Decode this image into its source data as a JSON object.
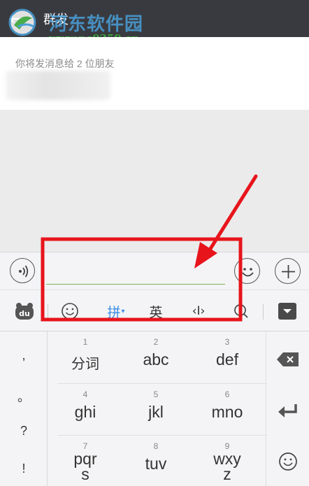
{
  "header": {
    "back_icon": "back-arrow-icon",
    "title": "群发",
    "watermark": {
      "name": "河东软件园",
      "url": "www.pc0359.cn"
    }
  },
  "recipients": {
    "hint": "你将发消息给 2 位朋友"
  },
  "input_bar": {
    "voice_icon": "voice-icon",
    "message_value": "",
    "emoji_icon": "emoji-icon",
    "plus_icon": "plus-icon",
    "accent_color": "#7bb35a"
  },
  "keyboard_toolbar": {
    "logo_icon": "baidu-du-icon",
    "emoji_icon": "smiley-icon",
    "pinyin_label": "拼",
    "english_label": "英",
    "cursor_label": "‹I›",
    "search_icon": "search-icon",
    "collapse_icon": "collapse-keyboard-icon",
    "active_color": "#3a8ee6"
  },
  "keyboard": {
    "punctuation": [
      ",",
      "。",
      "?",
      "!"
    ],
    "keys": [
      {
        "num": "1",
        "label": "分词"
      },
      {
        "num": "2",
        "label": "abc"
      },
      {
        "num": "3",
        "label": "def"
      },
      {
        "num": "4",
        "label": "ghi"
      },
      {
        "num": "5",
        "label": "jkl"
      },
      {
        "num": "6",
        "label": "mno"
      },
      {
        "num": "7",
        "label": "pqrs"
      },
      {
        "num": "8",
        "label": "tuv"
      },
      {
        "num": "9",
        "label": "wxyz"
      }
    ],
    "backspace_icon": "backspace-icon",
    "enter_icon": "enter-icon",
    "emoji_icon": "smiley-icon"
  },
  "annotation": {
    "color": "#e8141c",
    "highlight": "red-box-around-input",
    "pointer": "red-arrow-icon"
  }
}
